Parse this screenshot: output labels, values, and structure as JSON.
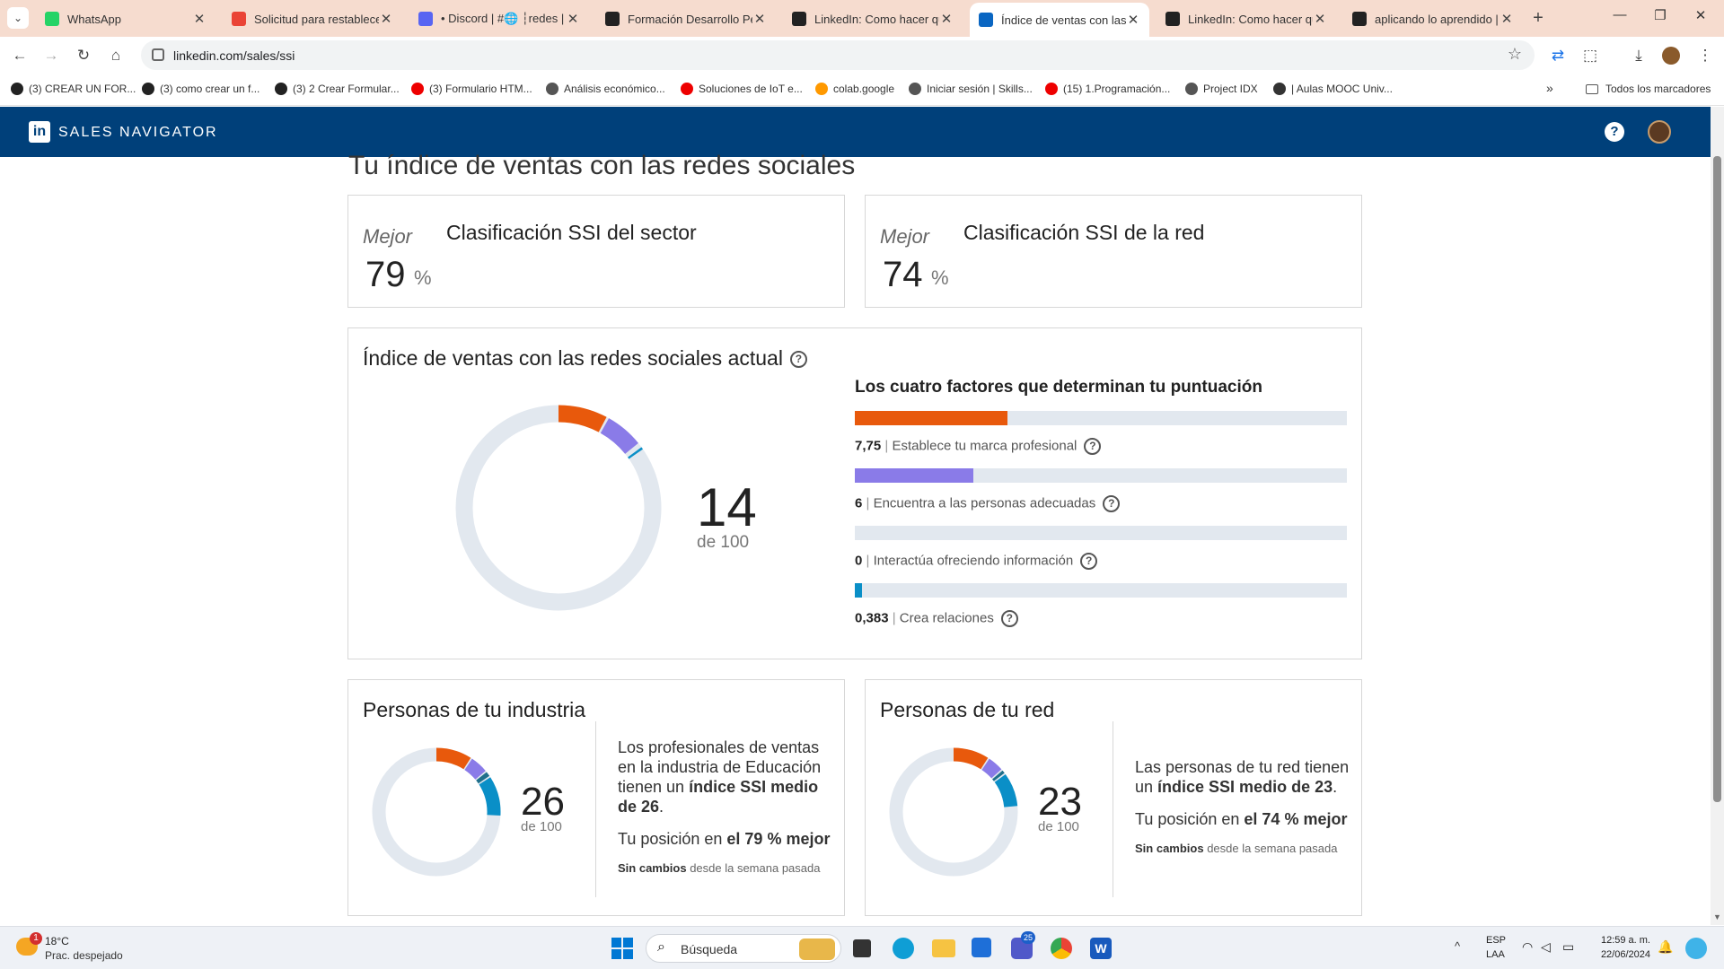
{
  "tabs": [
    {
      "title": "WhatsApp",
      "color": "#25d366"
    },
    {
      "title": "Solicitud para restablecer",
      "color": "#ea4335"
    },
    {
      "title": "• Discord | #🌐 ┆redes | Se",
      "color": "#5865f2"
    },
    {
      "title": "Formación Desarrollo Per",
      "color": "#222222"
    },
    {
      "title": "LinkedIn: Como hacer que",
      "color": "#222222"
    },
    {
      "title": "Índice de ventas con las r",
      "color": "#0a66c2"
    },
    {
      "title": "LinkedIn: Como hacer que",
      "color": "#222222"
    },
    {
      "title": "aplicando lo aprendido | I",
      "color": "#222222"
    }
  ],
  "address": "linkedin.com/sales/ssi",
  "bookmarks": [
    "(3) CREAR UN FOR...",
    "(3) como crear un f...",
    "(3) 2 Crear Formular...",
    "(3) Formulario HTM...",
    "Análisis económico...",
    "Soluciones de IoT e...",
    "colab.google",
    "Iniciar sesión | Skills...",
    "(15) 1.Programación...",
    "Project IDX",
    "| Aulas MOOC Univ..."
  ],
  "bookmarks_all": "Todos los marcadores",
  "brand": "SALES NAVIGATOR",
  "page_title": "Tu índice de ventas con las redes sociales",
  "rank_cards": [
    {
      "prefix": "Mejor",
      "title": "Clasificación SSI del sector",
      "value": "79",
      "unit": "%"
    },
    {
      "prefix": "Mejor",
      "title": "Clasificación SSI de la red",
      "value": "74",
      "unit": "%"
    }
  ],
  "current": {
    "title": "Índice de ventas con las redes sociales actual",
    "score": "14",
    "of": "de 100",
    "factors_title": "Los cuatro factores que determinan tu puntuación",
    "factors": [
      {
        "value": "7,75",
        "label": "Establece tu marca profesional",
        "fraction": 0.31,
        "color": "#e8590c"
      },
      {
        "value": "6",
        "label": "Encuentra a las personas adecuadas",
        "fraction": 0.24,
        "color": "#8a7be8"
      },
      {
        "value": "0",
        "label": "Interactúa ofreciendo información",
        "fraction": 0.0,
        "color": "#0a8fc7"
      },
      {
        "value": "0,383",
        "label": "Crea relaciones",
        "fraction": 0.015,
        "color": "#0a8fc7"
      }
    ]
  },
  "industry": {
    "title": "Personas de tu industria",
    "score": "26",
    "of": "de 100",
    "text_a": "Los profesionales de ventas en la industria de Educación tienen un ",
    "text_b": "índice SSI medio de 26",
    "text_c": ".",
    "pos_a": "Tu posición en ",
    "pos_b": "el 79 % mejor",
    "change_a": "Sin cambios",
    "change_b": " desde la semana pasada"
  },
  "network": {
    "title": "Personas de tu red",
    "score": "23",
    "of": "de 100",
    "text_a": "Las personas de tu red tienen un ",
    "text_b": "índice SSI medio de 23",
    "text_c": ".",
    "pos_a": "Tu posición en ",
    "pos_b": "el 74 % mejor",
    "change_a": "Sin cambios",
    "change_b": " desde la semana pasada"
  },
  "taskbar": {
    "temp": "18°C",
    "weather": "Prac. despejado",
    "search": "Búsqueda",
    "lang1": "ESP",
    "lang2": "LAA",
    "time": "12:59 a. m.",
    "date": "22/06/2024",
    "badge_weather": "1",
    "badge_teams": "25"
  }
}
